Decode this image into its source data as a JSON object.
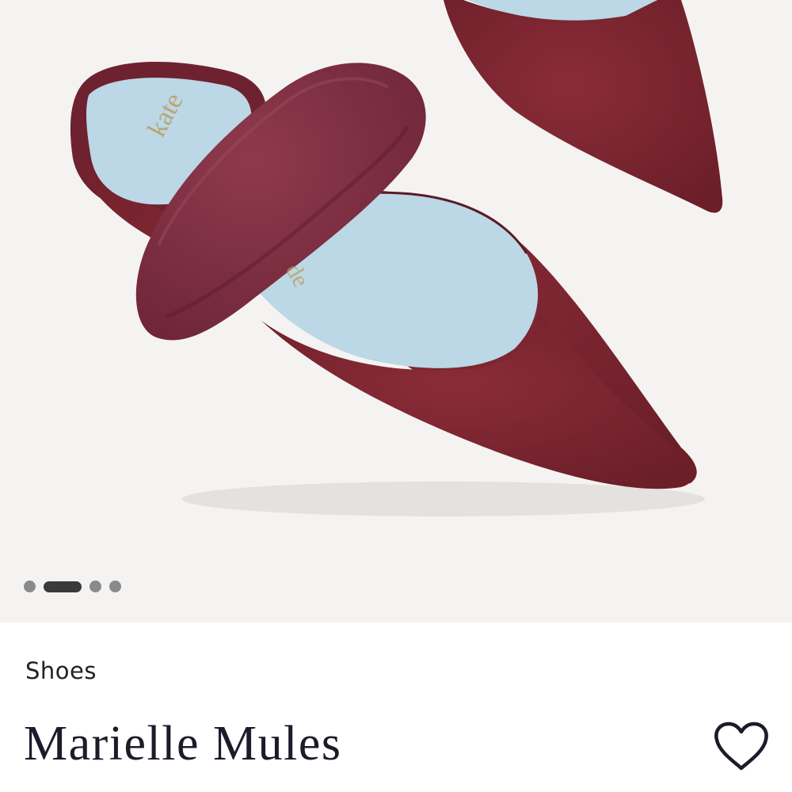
{
  "product": {
    "category": "Shoes",
    "name": "Marielle Mules"
  },
  "gallery": {
    "image_alt": "burgundy suede pointed-toe mules with faux fur strap",
    "slide_count": 4,
    "active_slide": 2,
    "image_brand_lettering": "kate spade"
  },
  "icons": {
    "wishlist": "heart-outline-icon"
  },
  "colors": {
    "suede": "#7a2430",
    "lining": "#bcd7e6",
    "background": "#f4f3f1",
    "text": "#1b1b2a"
  }
}
